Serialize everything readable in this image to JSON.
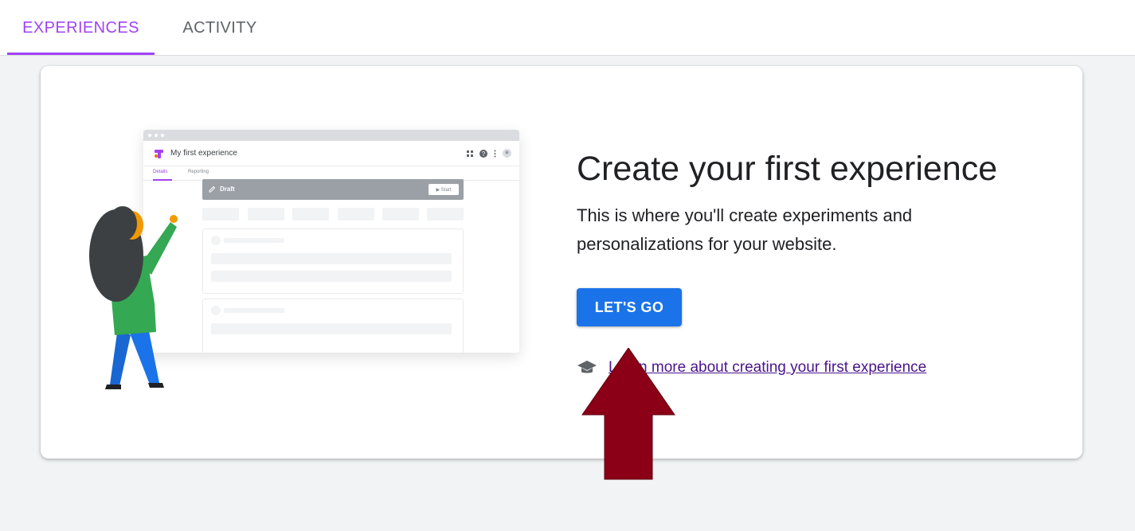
{
  "tabs": [
    {
      "label": "EXPERIENCES",
      "active": true
    },
    {
      "label": "ACTIVITY",
      "active": false
    }
  ],
  "colors": {
    "accent": "#a142f4",
    "primary_button": "#1a73e8",
    "link": "#4a148c",
    "arrow": "#8b0016"
  },
  "empty_state": {
    "title": "Create your first experience",
    "description": "This is where you'll create experiments and personalizations for your website.",
    "cta_label": "LET'S GO",
    "learn_more_icon": "graduation-cap-icon",
    "learn_more_label": "Learn more about creating your first experience"
  },
  "illustration": {
    "window_title": "My first experience",
    "tab_details": "Details",
    "tab_reporting": "Reporting",
    "status_label": "Draft",
    "start_label": "▶ Start"
  }
}
